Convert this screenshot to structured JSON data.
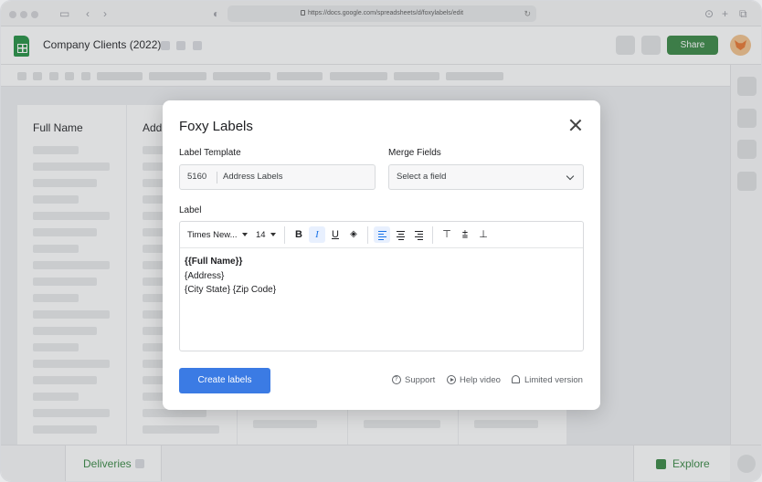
{
  "browser": {
    "url": "https://docs.google.com/spreadsheets/d/foxylabels/edit"
  },
  "app": {
    "title": "Company Clients (2022)",
    "share_label": "Share",
    "accent_color": "#34853f"
  },
  "sheet": {
    "columns": [
      "Full Name",
      "Addr"
    ]
  },
  "bottom": {
    "tab_label": "Deliveries",
    "explore_label": "Explore"
  },
  "modal": {
    "title": "Foxy Labels",
    "template_label": "Label Template",
    "template_number": "5160",
    "template_name": "Address Labels",
    "merge_label": "Merge Fields",
    "merge_value": "Select a field",
    "label_heading": "Label",
    "editor": {
      "font": "Times New...",
      "size": "14",
      "lines": [
        "{{Full Name}}",
        "{Address}",
        "{City State} {Zip Code}"
      ]
    },
    "create_label": "Create labels",
    "support_label": "Support",
    "help_label": "Help video",
    "limited_label": "Limited version",
    "button_color": "#3b7be4"
  }
}
